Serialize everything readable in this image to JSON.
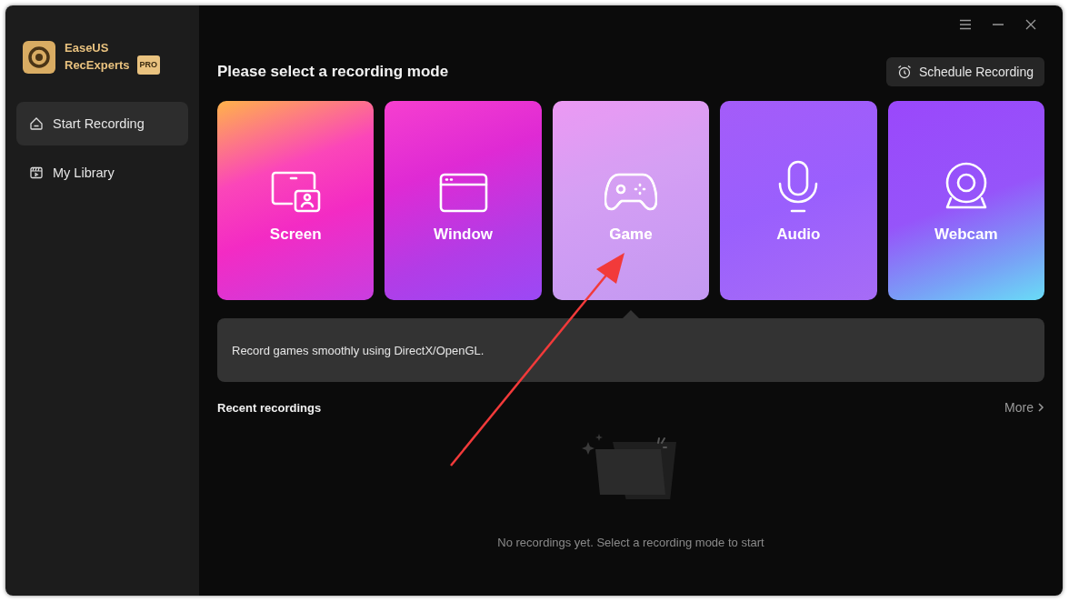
{
  "app": {
    "name_line_1": "EaseUS",
    "name_line_2": "RecExperts",
    "badge": "PRO"
  },
  "sidebar": {
    "items": [
      {
        "label": "Start Recording",
        "kind": "home",
        "selected": true
      },
      {
        "label": "My Library",
        "kind": "library",
        "selected": false
      }
    ]
  },
  "title": "Please select a recording mode",
  "schedule_button": "Schedule Recording",
  "modes": [
    {
      "label": "Screen",
      "kind": "screen",
      "selected": false
    },
    {
      "label": "Window",
      "kind": "window",
      "selected": false
    },
    {
      "label": "Game",
      "kind": "game",
      "selected": true
    },
    {
      "label": "Audio",
      "kind": "audio",
      "selected": false
    },
    {
      "label": "Webcam",
      "kind": "webcam",
      "selected": false
    }
  ],
  "description": "Record games smoothly using DirectX/OpenGL.",
  "recent": {
    "title": "Recent recordings",
    "more": "More",
    "empty_message": "No recordings yet. Select a recording mode to start"
  }
}
